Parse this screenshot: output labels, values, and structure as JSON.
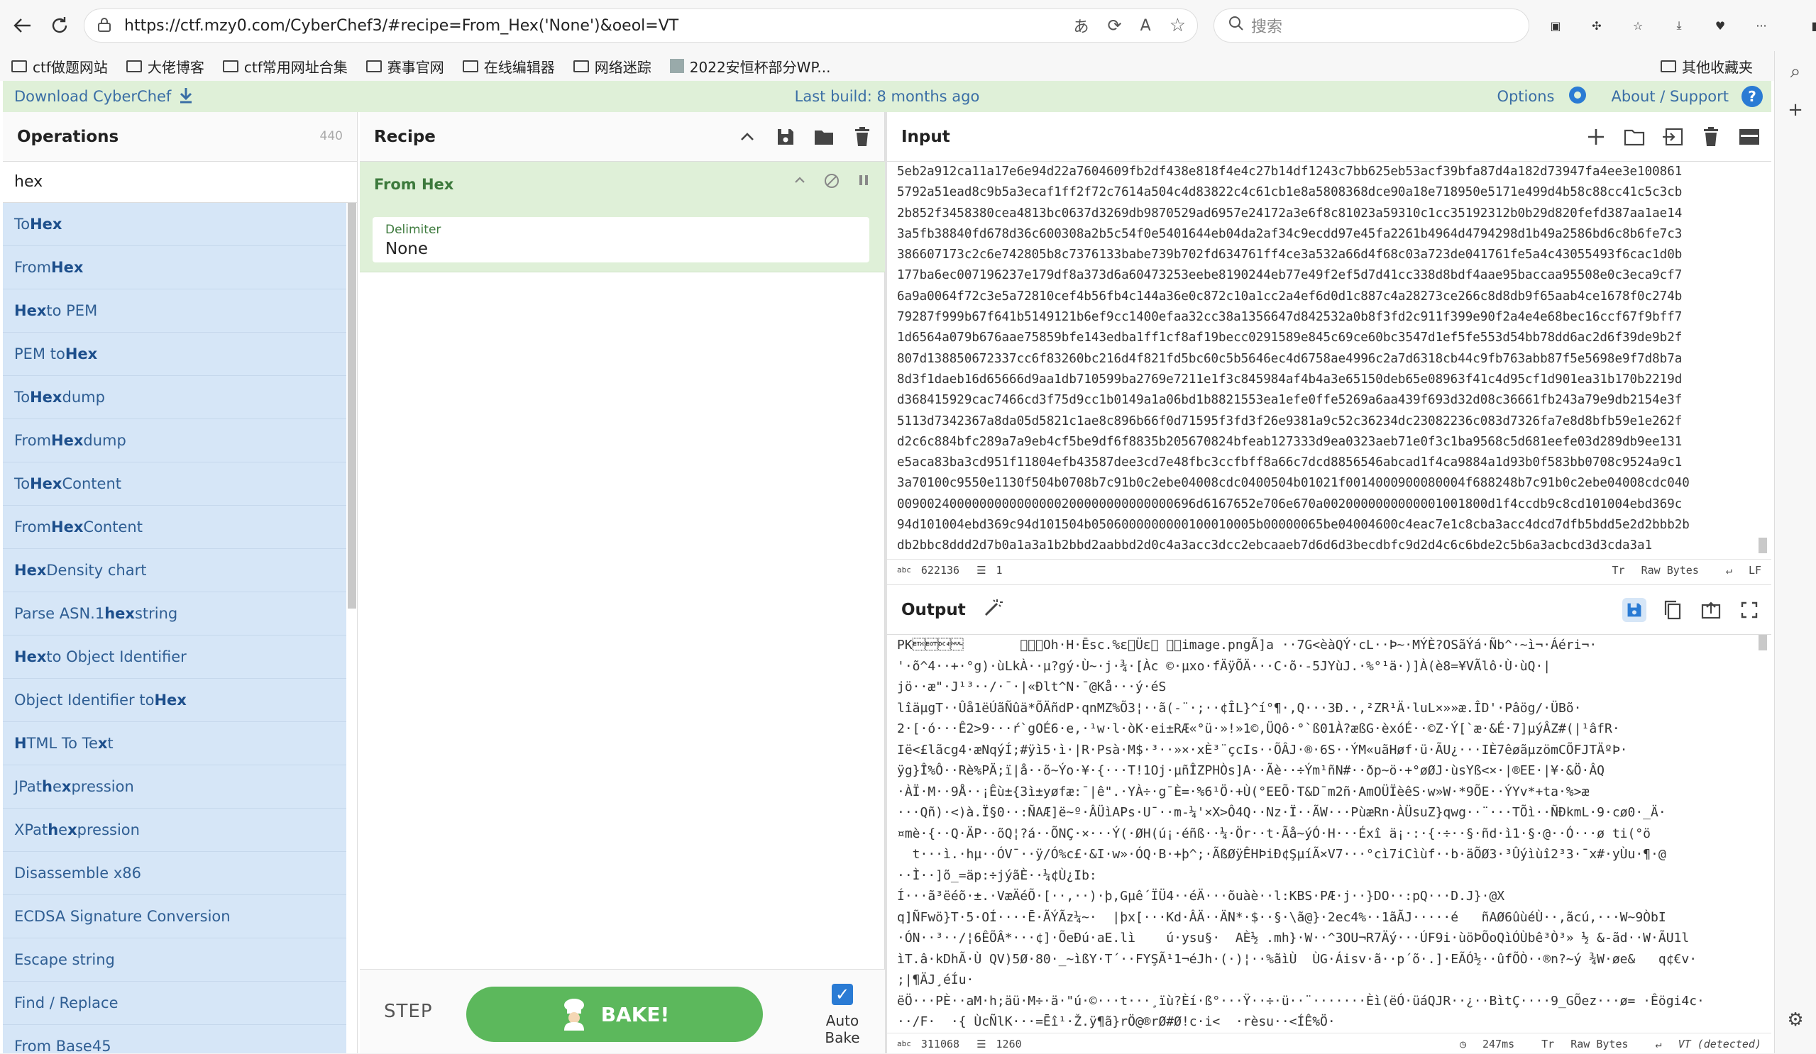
{
  "browser": {
    "url": "https://ctf.mzy0.com/CyberChef3/#recipe=From_Hex('None')&oeol=VT",
    "search_placeholder": "搜索",
    "bookmarks": [
      "ctf做题网站",
      "大佬博客",
      "ctf常用网址合集",
      "赛事官网",
      "在线编辑器",
      "网络迷踪",
      "2022安恒杯部分WP..."
    ],
    "other_bookmarks": "其他收藏夹"
  },
  "banner": {
    "download": "Download CyberChef",
    "last_build": "Last build: 8 months ago",
    "options": "Options",
    "about": "About / Support"
  },
  "operations": {
    "title": "Operations",
    "count": "440",
    "search_value": "hex",
    "items": [
      [
        "To ",
        "Hex",
        ""
      ],
      [
        "From ",
        "Hex",
        ""
      ],
      [
        "",
        "Hex",
        " to PEM"
      ],
      [
        "PEM to ",
        "Hex",
        ""
      ],
      [
        "To ",
        "Hex",
        "dump"
      ],
      [
        "From ",
        "Hex",
        "dump"
      ],
      [
        "To ",
        "Hex",
        " Content"
      ],
      [
        "From ",
        "Hex",
        " Content"
      ],
      [
        "",
        "Hex",
        " Density chart"
      ],
      [
        "Parse ASN.1 ",
        "hex",
        " string"
      ],
      [
        "",
        "Hex",
        " to Object Identifier"
      ],
      [
        "Object Identifier to ",
        "Hex",
        ""
      ],
      [
        "",
        "H",
        "TML To Te",
        "x",
        "t"
      ],
      [
        "JPat",
        "h",
        " e",
        "x",
        "pression"
      ],
      [
        "XPat",
        "h",
        " e",
        "x",
        "pression"
      ],
      [
        "Disassemble x86"
      ],
      [
        "ECDSA Signature Conversion"
      ],
      [
        "Escape string"
      ],
      [
        "Find / Replace"
      ],
      [
        "From Base45"
      ]
    ]
  },
  "recipe": {
    "title": "Recipe",
    "op_name": "From Hex",
    "delimiter_label": "Delimiter",
    "delimiter_value": "None",
    "step": "STEP",
    "bake": "BAKE!",
    "autobake": "Auto Bake"
  },
  "input": {
    "title": "Input",
    "lines": [
      "5eb2a912ca11a17e6e94d22a7604609fb2df438e818f4e4c27b14df1243c7bb625eb53acf39bfa87d4a182d73947fa4ee3e100861",
      "5792a51ead8c9b5a3ecaf1ff2f72c7614a504c4d83822c4c61cb1e8a5808368dce90a18e718950e5171e499d4b58c88cc41c5c3cb",
      "2b852f3458380cea4813bc0637d3269db9870529ad6957e24172a3e6f8c81023a59310c1cc35192312b0b29d820fefd387aa1ae14",
      "3a5fb38840fd678d36c600308a2b5c54f0e5401644eb04da2af34c9ecdd97e45fa2261b4964d4794298d1b49a2586bd6c8b6fe7c3",
      "386607173c2c6e742805b8c7376133babe739b702fd634761ff4ce3a532a66d4f68c03a723de041761fe5a4c43055493f6cac1d0b",
      "177ba6ec007196237e179df8a373d6a60473253eebe8190244eb77e49f2ef5d7d41cc338d8bdf4aae95baccaa95508e0c3eca9cf7",
      "6a9a0064f72c3e5a72810cef4b56fb4c144a36e0c872c10a1cc2a4ef6d0d1c887c4a28273ce266c8d8db9f65aab4ce1678f0c274b",
      "79287f999b67f641b5149121b6ef9cc1400efaa32cc38a1356647d842532a0b8f3fd2c911f399e90f2a4e4e68bec16ccf67f9bff7",
      "1d6564a079b676aae75859bfe143edba1ff1cf8af19becc0291589e845c69ce60bc3547d1ef5fe553d54bb78dd6ac2d6f39de9b2f",
      "807d138850672337cc6f83260bc216d4f821fd5bc60c5b5646ec4d6758ae4996c2a7d6318cb44c9fb763abb87f5e5698e9f7d8b7a",
      "8d3f1daeb16d65666d9aa1db710599ba2769e7211e1f3c845984af4b4a3e65150deb65e08963f41c4d95cf1d901ea31b170b2219d",
      "d368415929cac7466cd3f75d9cc1b0149a1a06bd1b8821553ea1efe0ffe5269a6aa439f693d32d08c36661fb243a79e9db2154e3f",
      "5113d7342367a8da05d5821c1ae8c896b66f0d71595f3fd3f26e9381a9c52c36234dc23082236c083d7326fa7e8d8bfb59e1e262f",
      "d2c6c884bfc289a7a9eb4cf5be9df6f8835b205670824bfeab127333d9ea0323aeb71e0f3c1ba9568c5d681eefe03d289db9ee131",
      "e5aca83ba3cd951f11804efb43587dee3cd7e48fbc3ccfbff8a66c7dcd8856546abcad1f4ca9884a1d93b0f583bb0708c9524a9c1",
      "3a70100c9550e1130f504b0708b7c91b0c2ebe04008cdc0400504b01021f0014000900080004f688248b7c91b0c2ebe04008cdc040",
      "0090024000000000000000200000000000000696d6167652e706e670a0020000000000001001800d1f4ccdb9c8cd101004ebd369c",
      "94d101004ebd369c94d101504b0506000000000100010005b00000065be04004600c4eac7e1c8cba3acc4dcd7dfb5bdd5e2d2bbb2b",
      "db2bbc8ddd2d7b0a1a3a1b2bbd2aabbd2d0c4a3acc3dcc2ebcaaeb7d6d6d3becdbfc9d2d4c6c6bde2c5b6a3acbcd3d3cda3a1"
    ],
    "length": "622136",
    "lines_count": "1",
    "raw": "Raw Bytes",
    "eol": "LF"
  },
  "output": {
    "title": "Output",
    "lines": [
      "PK\u0003\u0004\u0014\u0000\t\u0000\b\u0000Oh·H·Ēsc.%ɛ\u0000Üɛ\u0000 \u0000\u0000image.pngÃ]a ··7G<èàQÝ·cL··Þ~·MÝÈ?OSãÝá·Ñb^·~ì¬·Áéri¬·",
      "'·õ^4··+·°g)·ùLkÀ··µ?gý·Ù~·j·¾·[Àc ©·µxo·fÄÿÕÄ···C·õ·-5JYùJ.·%°¹ä·)]À(è8=¥VÃlô·Ù·ùQ·|",
      "jö··æ\"·J¹³··/·¯·|«Ðlt^N·¯@Kå···ý·éS",
      "lîäµgT··Ûå1ëÚãÑûä*ÕÄñdP·qnMZ%Õ3¦··ã(-¨·;··¢ÎL}^í°¶·,Q···3Ð.·,²ZR¹Ä·luL×»»æ.ÎD'·Pâög/·ÜBõ·",
      "2·[·ó···Ê2>9···ŕ`gOÉ6·e,·¹w·l·òK·ei±RÆ«°ü·»!»1©,ÜQô·°`ß01À?æßG·èxóÉ··©Z·Ý[`æ·&É·7]µýÂZ#(|¹âfR·",
      "Ië<£lãcg4·æNqýÍ;#ÿì5·ì·|R·Psà·M$·³··»×·xÈ³¨çcIs··ÕÂJ·®·6S··ÝM«uãHøf·ü·ÃU¿···IÈ7êøãµzömCÕFJTÄºÞ·",
      "ÿg}Î%Ô··Rè%PÄ;ï|å··õ~Ýo·¥·{···T!1Oj·µñÎZPHÒs]A··Ãè··÷Ým¹ñN#··ðp~ö·+°øØJ·ùsYß<×·|®EE·|¥·&Ö·ÂQ",
      "·ÀÏ·M··9Å··¡Êù±{3ì±yøfæ:¯|ê\".·YÀ÷·g¯È=·%6¹Ö·+Ù(°EEÕ·T&D¯m2ñ·AmOÜÏèêS·w»W·*9ÕE··ÝYv*+ta·%>æ",
      "···Qñ)·<)à.Ï§0··:ÑAÆ]ë~º·ÂÜìAPs·U¯··m-¼'×X>Ô4Q··Nz·Ï··ÃW···PùæRn·ÀÜsuZ}qwg··¨···TÕì··ÑÐkmL·9·cø0·_Ä·",
      "¤mè·{··Q·ÄP··õQ¦?á··ÕNÇ·×···Ý(·ØH(ú¡·éñß··¼·Ör··t·Ãå~ýÓ·H···Éxî ä¡·:·{·÷··§·ñd·ì1·§·@··Ó···ø ti(°ö",
      "  t···ì.·hµ··ÓV¯··ÿ/Ó%c£·&I·w»·ÓQ·B·+þ^;·ÃßØÿÊHÞiÐ¢ŞµíÃ×V7···°cì7iCìùf··b·äÕØ3·³Ûýìùî2³3·¯x#·yÙu·¶·@",
      "··Ì··]õ_=äp:÷jýãÈ··¼¢Ù¿Ib:",
      "Í···ã³ëéõ·±.·VæÄéÕ·[··,··)·þ,Gµê´ÏÜ4··éÄ···õuàè··l:KBS·PÆ·j··}DO··:pQ···D.J}·@X",
      "q]ÑFwö}T·5·OÍ····Ē·ÃÝÃz¼~·  |þx[···Kd·ÂÄ··ÄN*·$··§·\\ã@}·2ec4%··1ãÃJ·····é   ñAØ6ûùéÙ··,ãcú,···W~9ÒbI",
      "·ÓN··³··/¦6ÊÕÂ*···¢]·ÕeÐú·aE.lì    ú·ysu§·  AÈ½ .mh}·W··^3OU¬R7Äý···ÚF9i·ùöÞÕoQìÓÙbê³Ò³» ½ &-ãd··W·ÃU1l",
      "ìT.â·kDhÃ·Ù QV)5Ø·80·_~ìßY·T´··FYŞÃ¹1¬éJh·(·)¦··%ãìÙ  ÙG·Áisv·ã··p´õ·.]·EÃÓ½··ûfÕÒ··®n?~ý ¾W·øe&   q¢€v·",
      ";|¶ÄJ¸éÍu·",
      "ëÖ···PÈ··aM·h;äü·M÷·ä·\"ú·©···t···¸ïù?Èí·ß°···Ÿ··÷·ü··¨·······Èì(ëÓ·üáQJR··¿··BìtÇ····9_GÕez···ø= ·Êögi4c·",
      "··/F·  ·{ ÙcÑlK···=Ēî¹·Ž.ÿ¶ã}rÖ@®rØ#Ø!c·i<  ·rèsu··<ÍÊ%Ö·"
    ],
    "length": "311068",
    "lines_count": "1260",
    "time": "247ms",
    "raw": "Raw Bytes",
    "eol": "VT (detected)"
  },
  "colors": {
    "accent": "#5cb85c",
    "link": "#3a6ea5",
    "ops_bg": "#d6e6f7",
    "control": "#d23"
  }
}
